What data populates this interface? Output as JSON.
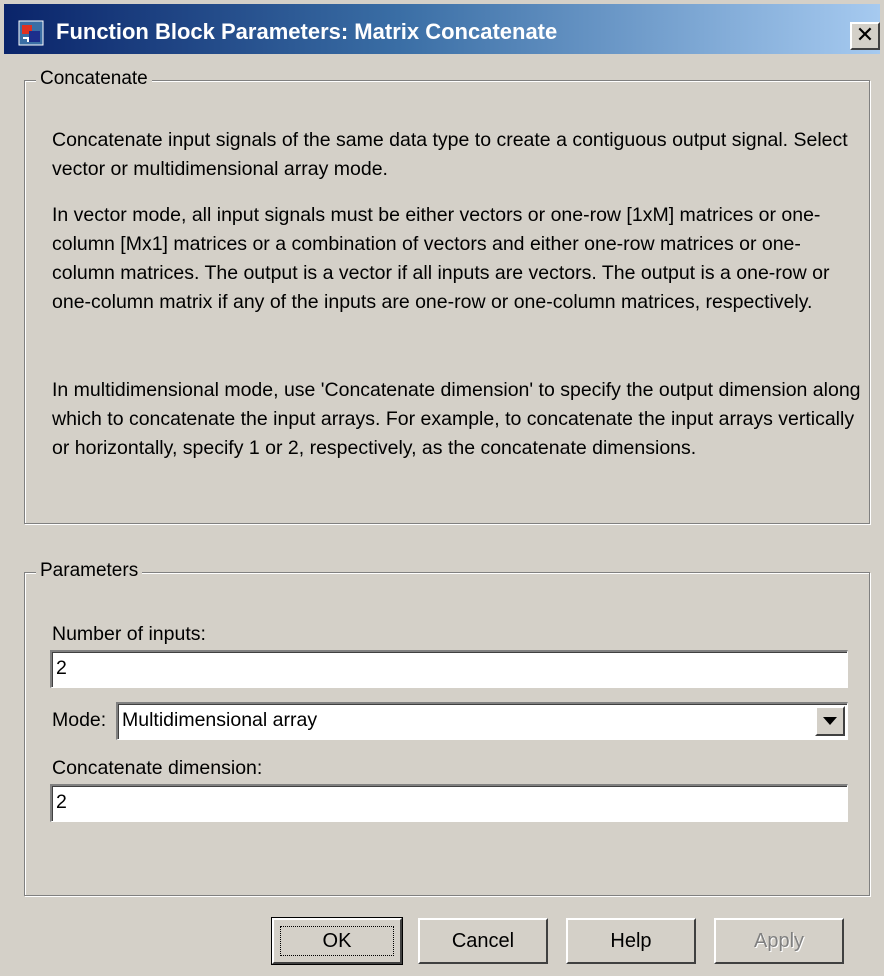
{
  "window": {
    "title": "Function Block Parameters: Matrix Concatenate",
    "close_label": "✕"
  },
  "concatenate_group": {
    "legend": "Concatenate",
    "paragraphs": [
      "Concatenate input signals of the same data type to create a contiguous output signal. Select vector or multidimensional array mode.",
      "In vector mode, all input signals must be either vectors or one-row [1xM] matrices or one-column [Mx1] matrices or a combination of vectors and either one-row matrices or one-column matrices. The output is a vector if all inputs are vectors. The output is a one-row or one-column matrix if any of the inputs are one-row or one-column matrices, respectively.",
      "In multidimensional mode, use 'Concatenate dimension' to specify the output dimension along which to concatenate the input arrays. For example, to concatenate the input arrays vertically or horizontally, specify 1 or 2, respectively, as the concatenate dimensions."
    ]
  },
  "parameters_group": {
    "legend": "Parameters",
    "number_of_inputs": {
      "label": "Number of inputs:",
      "value": "2"
    },
    "mode": {
      "label": "Mode:",
      "value": "Multidimensional array"
    },
    "concatenate_dimension": {
      "label": "Concatenate dimension:",
      "value": "2"
    }
  },
  "buttons": {
    "ok": "OK",
    "cancel": "Cancel",
    "help": "Help",
    "apply": "Apply"
  }
}
